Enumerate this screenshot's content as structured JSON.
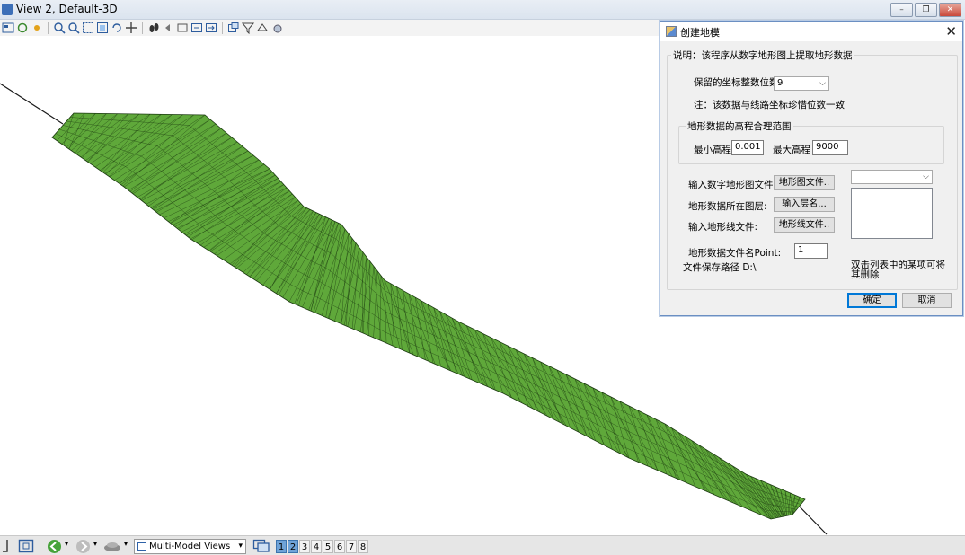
{
  "view_window": {
    "title": "View 2, Default-3D",
    "minimize_glyph": "–",
    "restore_glyph": "❐",
    "close_glyph": "✕"
  },
  "toolbar": {
    "icons": [
      "view-attributes-icon",
      "refresh-icon",
      "camera-icon",
      "zoom-in-icon",
      "zoom-out-icon",
      "window-area-icon",
      "fit-view-icon",
      "rotate-view-icon",
      "pan-icon",
      "walk-icon",
      "previous-view-icon",
      "next-view-icon",
      "copy-view-icon",
      "clip-volume-icon",
      "display-style-icon"
    ]
  },
  "dialog": {
    "title": "创建地模",
    "close_glyph": "✕",
    "description": "说明：该程序从数字地形图上提取地形数据",
    "coord_digits_label": "保留的坐标整数位数",
    "coord_digits_value": "9",
    "note": "注：该数据与线路坐标珍惜位数一致",
    "elevation_group_label": "地形数据的高程合理范围",
    "min_elev_label": "最小高程",
    "min_elev_value": "0.001",
    "max_elev_label": "最大高程",
    "max_elev_value": "9000",
    "dtm_file_label": "输入数字地形图文件:",
    "dtm_file_button": "地形图文件..",
    "layer_label": "地形数据所在图层:",
    "layer_button": "输入层名...",
    "terrain_line_label": "输入地形线文件:",
    "terrain_line_button": "地形线文件..",
    "layer_combo_value": "",
    "data_file_label": "地形数据文件名Point:",
    "data_file_value": "1",
    "save_path": "文件保存路径 D:\\",
    "list_hint": "双击列表中的某项可将其删除",
    "ok_button": "确定",
    "cancel_button": "取消"
  },
  "bottombar": {
    "views_select_value": "Multi-Model Views",
    "view_numbers": [
      "1",
      "2",
      "3",
      "4",
      "5",
      "6",
      "7",
      "8"
    ],
    "active_views": [
      "1",
      "2"
    ]
  },
  "colors": {
    "mesh_fill": "#5fa83a",
    "mesh_edge": "#1b3a10",
    "accent": "#0078d7"
  }
}
